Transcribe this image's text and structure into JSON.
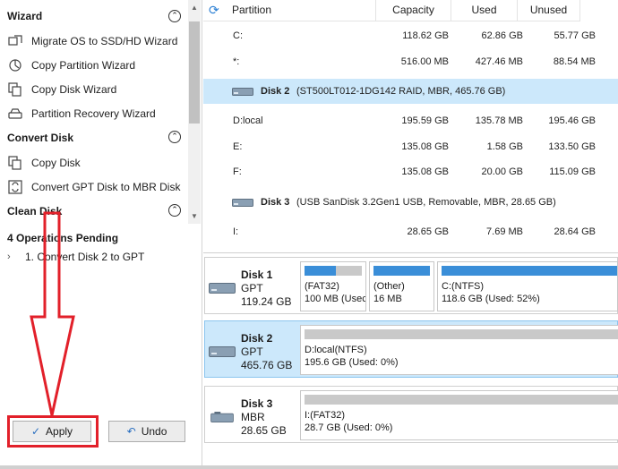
{
  "sidebar": {
    "wizard": {
      "title": "Wizard",
      "items": [
        {
          "label": "Migrate OS to SSD/HD Wizard",
          "icon": "migrate-icon"
        },
        {
          "label": "Copy Partition Wizard",
          "icon": "copy-partition-icon"
        },
        {
          "label": "Copy Disk Wizard",
          "icon": "copy-disk-icon"
        },
        {
          "label": "Partition Recovery Wizard",
          "icon": "partition-recovery-icon"
        }
      ]
    },
    "convert_disk": {
      "title": "Convert Disk",
      "items": [
        {
          "label": "Copy Disk",
          "icon": "copy-disk-icon"
        },
        {
          "label": "Convert GPT Disk to MBR Disk",
          "icon": "convert-icon"
        }
      ]
    },
    "clean_disk": {
      "title": "Clean Disk"
    },
    "pending": {
      "title": "4 Operations Pending",
      "items": [
        "1. Convert Disk 2 to GPT"
      ]
    },
    "apply_label": "Apply",
    "undo_label": "Undo"
  },
  "table": {
    "headers": {
      "partition": "Partition",
      "capacity": "Capacity",
      "used": "Used",
      "unused": "Unused"
    },
    "rows": [
      {
        "partition": "C:",
        "capacity": "118.62 GB",
        "used": "62.86 GB",
        "unused": "55.77 GB"
      },
      {
        "partition": "*:",
        "capacity": "516.00 MB",
        "used": "427.46 MB",
        "unused": "88.54 MB"
      },
      {
        "disk_name": "Disk 2",
        "disk_desc": "(ST500LT012-1DG142 RAID, MBR, 465.76 GB)"
      },
      {
        "partition": "D:local",
        "capacity": "195.59 GB",
        "used": "135.78 MB",
        "unused": "195.46 GB"
      },
      {
        "partition": "E:",
        "capacity": "135.08 GB",
        "used": "1.58 GB",
        "unused": "133.50 GB"
      },
      {
        "partition": "F:",
        "capacity": "135.08 GB",
        "used": "20.00 GB",
        "unused": "115.09 GB"
      },
      {
        "disk_name": "Disk 3",
        "disk_desc": "(USB SanDisk 3.2Gen1 USB, Removable, MBR, 28.65 GB)"
      },
      {
        "partition": "I:",
        "capacity": "28.65 GB",
        "used": "7.69 MB",
        "unused": "28.64 GB"
      }
    ]
  },
  "disk_map": [
    {
      "name": "Disk 1",
      "type": "GPT",
      "size": "119.24 GB",
      "icon": "hdd-icon",
      "partitions": [
        {
          "label": "(FAT32)",
          "sub": "100 MB (Usec",
          "used_fraction": 0.55
        },
        {
          "label": "(Other)",
          "sub": "16 MB",
          "used_fraction": 1.0
        },
        {
          "label": "C:(NTFS)",
          "sub": "118.6 GB (Used: 52%)",
          "used_fraction": 1.0
        }
      ]
    },
    {
      "name": "Disk 2",
      "type": "GPT",
      "size": "465.76 GB",
      "icon": "hdd-icon",
      "partitions": [
        {
          "label": "D:local(NTFS)",
          "sub": "195.6 GB (Used: 0%)",
          "used_fraction": 0.0
        }
      ]
    },
    {
      "name": "Disk 3",
      "type": "MBR",
      "size": "28.65 GB",
      "icon": "usb-drive-icon",
      "partitions": [
        {
          "label": "I:(FAT32)",
          "sub": "28.7 GB (Used: 0%)",
          "used_fraction": 0.0
        }
      ]
    }
  ],
  "colors": {
    "accent": "#3a8ed8",
    "selection": "#cce8fb",
    "highlight_red": "#e2202a"
  }
}
